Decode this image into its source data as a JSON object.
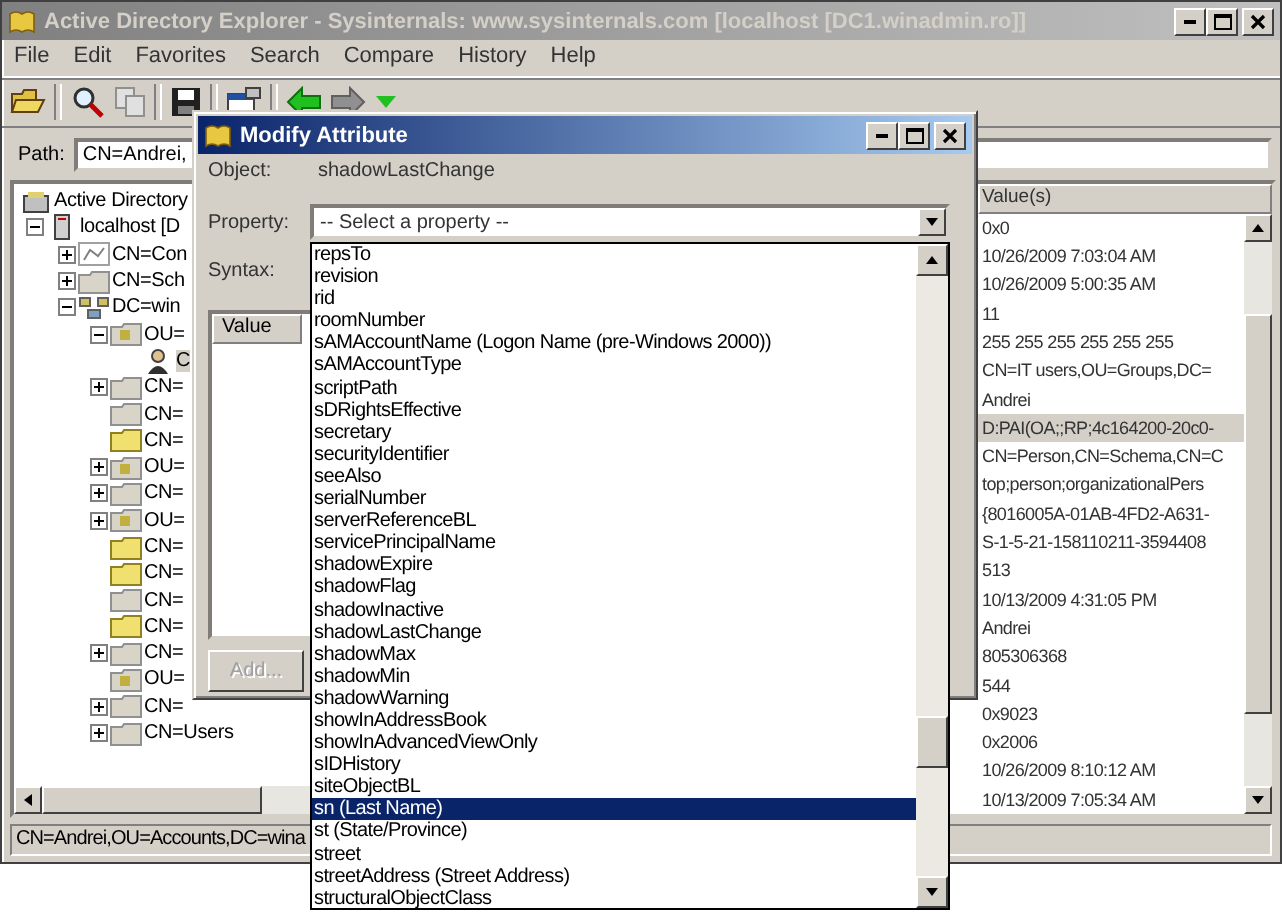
{
  "window": {
    "title": "Active Directory Explorer - Sysinternals: www.sysinternals.com [localhost [DC1.winadmin.ro]]",
    "active": false
  },
  "menu": [
    "File",
    "Edit",
    "Favorites",
    "Search",
    "Compare",
    "History",
    "Help"
  ],
  "path": {
    "label": "Path:",
    "value": "CN=Andrei,"
  },
  "tree": {
    "items": [
      {
        "label": "Active Directory",
        "kind": "root",
        "children": [
          {
            "label": "localhost [D",
            "kind": "server",
            "expanded": true,
            "children": [
              {
                "label": "CN=Con",
                "kind": "config",
                "expanded": false
              },
              {
                "label": "CN=Sch",
                "kind": "container",
                "expanded": false
              },
              {
                "label": "DC=win",
                "kind": "domain",
                "expanded": true,
                "children": [
                  {
                    "label": "OU=",
                    "kind": "ou",
                    "expanded": true,
                    "children": [
                      {
                        "label": "C",
                        "kind": "user",
                        "selected": true
                      }
                    ]
                  },
                  {
                    "label": "CN=",
                    "kind": "container",
                    "expanded": false
                  },
                  {
                    "label": "CN=",
                    "kind": "container"
                  },
                  {
                    "label": "CN=",
                    "kind": "folder"
                  },
                  {
                    "label": "OU=",
                    "kind": "ou",
                    "expanded": false
                  },
                  {
                    "label": "CN=",
                    "kind": "container",
                    "expanded": false
                  },
                  {
                    "label": "OU=",
                    "kind": "ou",
                    "expanded": false
                  },
                  {
                    "label": "CN=",
                    "kind": "folder"
                  },
                  {
                    "label": "CN=",
                    "kind": "folder"
                  },
                  {
                    "label": "CN=",
                    "kind": "container"
                  },
                  {
                    "label": "CN=",
                    "kind": "folder"
                  },
                  {
                    "label": "CN=",
                    "kind": "container",
                    "expanded": false
                  },
                  {
                    "label": "OU=",
                    "kind": "ou"
                  },
                  {
                    "label": "CN=",
                    "kind": "container",
                    "expanded": false
                  },
                  {
                    "label": "CN=Users",
                    "kind": "container",
                    "expanded": false
                  }
                ]
              }
            ]
          }
        ]
      }
    ]
  },
  "attributes": {
    "column": "Value(s)",
    "rows": [
      {
        "value": "0x0",
        "selected": false
      },
      {
        "value": "10/26/2009 7:03:04 AM",
        "selected": false
      },
      {
        "value": "10/26/2009 5:00:35 AM",
        "selected": false
      },
      {
        "value": "11",
        "selected": false
      },
      {
        "value": "255 255 255 255 255 255",
        "selected": false
      },
      {
        "value": "CN=IT users,OU=Groups,DC=",
        "selected": false
      },
      {
        "value": "Andrei",
        "selected": false
      },
      {
        "value": "D:PAI(OA;;RP;4c164200-20c0-",
        "selected": true
      },
      {
        "value": "CN=Person,CN=Schema,CN=C",
        "selected": false
      },
      {
        "value": "top;person;organizationalPers",
        "selected": false
      },
      {
        "value": "{8016005A-01AB-4FD2-A631-",
        "selected": false
      },
      {
        "value": "S-1-5-21-158110211-3594408",
        "selected": false
      },
      {
        "value": "513",
        "selected": false
      },
      {
        "value": "10/13/2009 4:31:05 PM",
        "selected": false
      },
      {
        "value": "Andrei",
        "selected": false
      },
      {
        "value": "805306368",
        "selected": false
      },
      {
        "value": "544",
        "selected": false
      },
      {
        "value": "0x9023",
        "selected": false
      },
      {
        "value": "0x2006",
        "selected": false
      },
      {
        "value": "10/26/2009 8:10:12 AM",
        "selected": false
      },
      {
        "value": "10/13/2009 7:05:34 AM",
        "selected": false
      }
    ]
  },
  "status_bar": "CN=Andrei,OU=Accounts,DC=wina",
  "dialog": {
    "title": "Modify Attribute",
    "active": true,
    "object_label": "Object:",
    "object_value": "shadowLastChange",
    "property_label": "Property:",
    "property_value": "-- Select a property --",
    "syntax_label": "Syntax:",
    "value_column": "Value",
    "add_button": {
      "label": "Add...",
      "disabled": true
    },
    "property_options": [
      {
        "label": "repsTo",
        "selected": false
      },
      {
        "label": "revision",
        "selected": false
      },
      {
        "label": "rid",
        "selected": false
      },
      {
        "label": "roomNumber",
        "selected": false
      },
      {
        "label": "sAMAccountName (Logon Name (pre-Windows 2000))",
        "selected": false
      },
      {
        "label": "sAMAccountType",
        "selected": false
      },
      {
        "label": "scriptPath",
        "selected": false
      },
      {
        "label": "sDRightsEffective",
        "selected": false
      },
      {
        "label": "secretary",
        "selected": false
      },
      {
        "label": "securityIdentifier",
        "selected": false
      },
      {
        "label": "seeAlso",
        "selected": false
      },
      {
        "label": "serialNumber",
        "selected": false
      },
      {
        "label": "serverReferenceBL",
        "selected": false
      },
      {
        "label": "servicePrincipalName",
        "selected": false
      },
      {
        "label": "shadowExpire",
        "selected": false
      },
      {
        "label": "shadowFlag",
        "selected": false
      },
      {
        "label": "shadowInactive",
        "selected": false
      },
      {
        "label": "shadowLastChange",
        "selected": false
      },
      {
        "label": "shadowMax",
        "selected": false
      },
      {
        "label": "shadowMin",
        "selected": false
      },
      {
        "label": "shadowWarning",
        "selected": false
      },
      {
        "label": "showInAddressBook",
        "selected": false
      },
      {
        "label": "showInAdvancedViewOnly",
        "selected": false
      },
      {
        "label": "sIDHistory",
        "selected": false
      },
      {
        "label": "siteObjectBL",
        "selected": false
      },
      {
        "label": "sn (Last Name)",
        "selected": true
      },
      {
        "label": "st (State/Province)",
        "selected": false
      },
      {
        "label": "street",
        "selected": false
      },
      {
        "label": "streetAddress (Street Address)",
        "selected": false
      },
      {
        "label": "structuralObjectClass",
        "selected": false
      }
    ]
  }
}
